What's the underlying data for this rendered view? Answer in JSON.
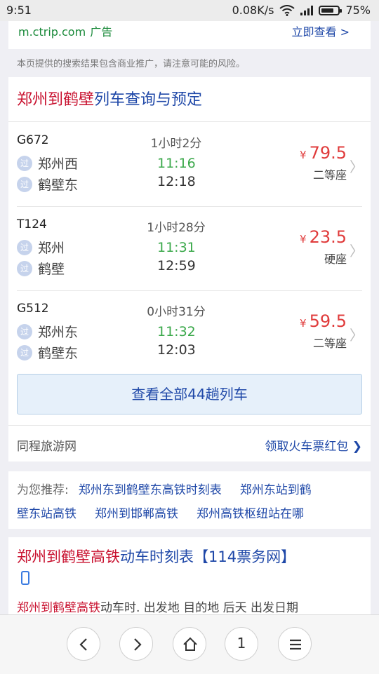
{
  "status": {
    "time": "9:51",
    "net_speed": "0.08K/s",
    "battery": "75%",
    "battery_fraction": 0.75
  },
  "ad": {
    "url": "m.ctrip.com",
    "tag": "广告",
    "link": "立即查看 >"
  },
  "notice": "本页提供的搜索结果包含商业推广，请注意可能的风险。",
  "trains_card": {
    "title_hl": "郑州到鹤壁",
    "title_rest": "列车查询与预定",
    "trains": [
      {
        "code": "G672",
        "duration": "1小时2分",
        "from": "郑州西",
        "to": "鹤壁东",
        "dep": "11:16",
        "arr": "12:18",
        "price": "79.5",
        "seat": "二等座"
      },
      {
        "code": "T124",
        "duration": "1小时28分",
        "from": "郑州",
        "to": "鹤壁",
        "dep": "11:31",
        "arr": "12:59",
        "price": "23.5",
        "seat": "硬座"
      },
      {
        "code": "G512",
        "duration": "0小时31分",
        "from": "郑州东",
        "to": "鹤壁东",
        "dep": "11:32",
        "arr": "12:03",
        "price": "59.5",
        "seat": "二等座"
      }
    ],
    "pass_label": "过",
    "currency": "¥",
    "chevron": "〉",
    "view_all": "查看全部44趟列车",
    "source": "同程旅游网",
    "coupon": "领取火车票红包 ❯"
  },
  "recommend": {
    "label": "为您推荐:",
    "links": [
      "郑州东到鹤壁东高铁时刻表",
      "郑州东站到鹤",
      "壁东站高铁",
      "郑州到邯郸高铁",
      "郑州高铁枢纽站在哪"
    ]
  },
  "result": {
    "title_hl": "郑州到鹤壁高铁",
    "title_rest": "动车时刻表【114票务网】",
    "snippet_hl": "郑州到鹤壁高铁",
    "snippet_rest": "动车时. 出发地 目的地 后天 出发日期"
  },
  "bottom_nav": {
    "page_count": "1",
    "icons": [
      "back-icon",
      "forward-icon",
      "home-icon",
      "tabs-count",
      "menu-icon"
    ]
  },
  "colors": {
    "link_blue": "#1f48a8",
    "highlight_red": "#c8102e",
    "price_red": "#e03c3c",
    "depart_green": "#3aa84a",
    "ad_green": "#1a8a3a"
  }
}
